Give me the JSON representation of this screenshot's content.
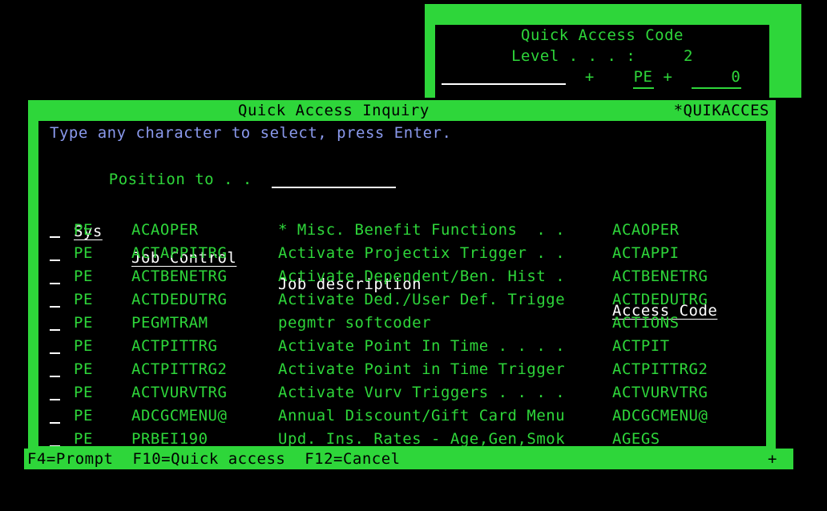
{
  "popup": {
    "title": "Quick Access Code",
    "level_label": "Level . . . :",
    "level_value": "2",
    "plus1": "+",
    "sys_value": "PE",
    "plus2": "+",
    "code_value": "0",
    "input_value": ""
  },
  "main": {
    "title": "Quick Access Inquiry",
    "system_name": "*QUIKACCES",
    "instruction": "Type any character to select, press Enter.",
    "position_label": "Position to . .",
    "position_value": "",
    "headers": {
      "select": "",
      "sys": "Sys",
      "job_control": "Job Control",
      "job_description": "Job description",
      "access_code": "Access Code"
    },
    "rows": [
      {
        "sel": "",
        "sys": "PE",
        "job": "ACAOPER",
        "desc": "* Misc. Benefit Functions  . .",
        "code": "ACAOPER"
      },
      {
        "sel": "",
        "sys": "PE",
        "job": "ACTAPPITRG",
        "desc": "Activate Projectix Trigger . .",
        "code": "ACTAPPI"
      },
      {
        "sel": "",
        "sys": "PE",
        "job": "ACTBENETRG",
        "desc": "Activate Dependent/Ben. Hist .",
        "code": "ACTBENETRG"
      },
      {
        "sel": "",
        "sys": "PE",
        "job": "ACTDEDUTRG",
        "desc": "Activate Ded./User Def. Trigge",
        "code": "ACTDEDUTRG"
      },
      {
        "sel": "",
        "sys": "PE",
        "job": "PEGMTRAM",
        "desc": "pegmtr softcoder",
        "code": "ACTIONS"
      },
      {
        "sel": "",
        "sys": "PE",
        "job": "ACTPITTRG",
        "desc": "Activate Point In Time . . . .",
        "code": "ACTPIT"
      },
      {
        "sel": "",
        "sys": "PE",
        "job": "ACTPITTRG2",
        "desc": "Activate Point in Time Trigger",
        "code": "ACTPITTRG2"
      },
      {
        "sel": "",
        "sys": "PE",
        "job": "ACTVURVTRG",
        "desc": "Activate Vurv Triggers . . . .",
        "code": "ACTVURVTRG"
      },
      {
        "sel": "",
        "sys": "PE",
        "job": "ADCGCMENU@",
        "desc": "Annual Discount/Gift Card Menu",
        "code": "ADCGCMENU@"
      },
      {
        "sel": "",
        "sys": "PE",
        "job": "PRBEI190",
        "desc": "Upd. Ins. Rates - Age,Gen,Smok",
        "code": "AGEGS"
      }
    ]
  },
  "function_keys": {
    "text": "F4=Prompt  F10=Quick access  F12=Cancel",
    "more_indicator": "+"
  },
  "colors": {
    "screen_background": "#000000",
    "terminal_green": "#2ed63a",
    "terminal_white": "#ffffff",
    "terminal_blue": "#8a99ec"
  }
}
